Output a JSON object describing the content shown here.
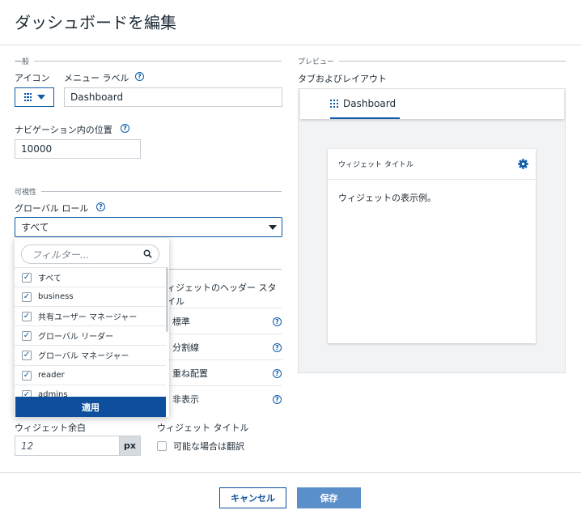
{
  "page": {
    "title": "ダッシュボードを編集"
  },
  "general": {
    "section_label": "一般",
    "icon_label": "アイコン",
    "menu_label_label": "メニュー ラベル",
    "menu_label_value": "Dashboard",
    "nav_position_label": "ナビゲーション内の位置",
    "nav_position_value": "10000"
  },
  "visibility": {
    "section_label": "可視性",
    "global_role_label": "グローバル ロール",
    "global_role_value": "すべて"
  },
  "role_dropdown": {
    "filter_placeholder": "フィルター…",
    "items": [
      {
        "label": "すべて",
        "checked": true
      },
      {
        "label": "business",
        "checked": true
      },
      {
        "label": "共有ユーザー マネージャー",
        "checked": true
      },
      {
        "label": "グローバル リーダー",
        "checked": true
      },
      {
        "label": "グローバル マネージャー",
        "checked": true
      },
      {
        "label": "reader",
        "checked": true
      },
      {
        "label": "admins",
        "checked": true
      }
    ],
    "apply_label": "適用"
  },
  "widget_header": {
    "label": "ィジェットのヘッダー スタイル",
    "options": [
      "標準",
      "分割線",
      "重ね配置",
      "非表示"
    ]
  },
  "widget_margin": {
    "label": "ウィジェット余白",
    "value": "12",
    "unit": "px"
  },
  "widget_title": {
    "label": "ウィジェット タイトル",
    "translate_label": "可能な場合は翻訳",
    "translate_checked": false
  },
  "preview": {
    "section_label": "プレビュー",
    "subtitle": "タブおよびレイアウト",
    "tab_label": "Dashboard",
    "widget_title": "ウィジェット タイトル",
    "widget_body": "ウィジェットの表示例。"
  },
  "footer": {
    "cancel_label": "キャンセル",
    "save_label": "保存"
  },
  "colors": {
    "accent": "#0d5aa7",
    "apply_bg": "#0d4f9c",
    "save_bg": "#5b8fc9"
  }
}
